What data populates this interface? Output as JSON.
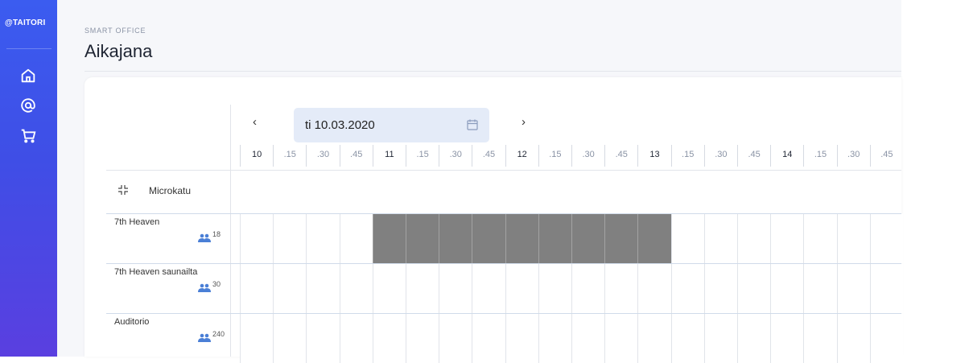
{
  "sidebar": {
    "brand": "@TAITORI",
    "items": [
      {
        "icon": "home-icon"
      },
      {
        "icon": "at-icon"
      },
      {
        "icon": "cart-icon"
      }
    ]
  },
  "header": {
    "eyebrow": "SMART OFFICE",
    "title": "Aikajana"
  },
  "date_picker": {
    "prev": "‹",
    "next": "›",
    "value": "ti 10.03.2020"
  },
  "timeline": {
    "ticks": [
      "10",
      ".15",
      ".30",
      ".45",
      "11",
      ".15",
      ".30",
      ".45",
      "12",
      ".15",
      ".30",
      ".45",
      "13",
      ".15",
      ".30",
      ".45",
      "14",
      ".15",
      ".30",
      ".45"
    ]
  },
  "group": {
    "label": "Microkatu"
  },
  "rooms": [
    {
      "name": "7th Heaven",
      "capacity": "18",
      "booked_slots": [
        4,
        5,
        6,
        7,
        8,
        9,
        10,
        11,
        12
      ]
    },
    {
      "name": "7th Heaven saunailta",
      "capacity": "30",
      "booked_slots": []
    },
    {
      "name": "Auditorio",
      "capacity": "240",
      "booked_slots": []
    }
  ],
  "colors": {
    "sidebar": "#3f4ee6",
    "booked": "#808080",
    "date_field": "#e4ebf8",
    "people_icon": "#4a7fd6"
  }
}
